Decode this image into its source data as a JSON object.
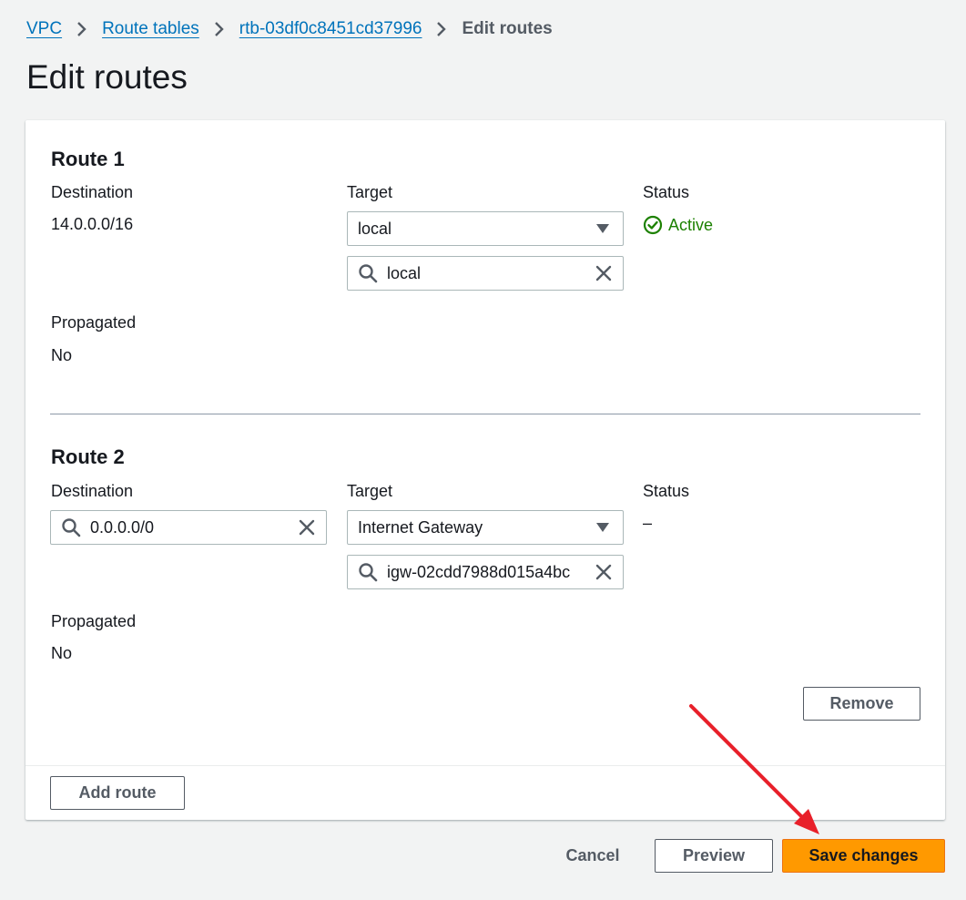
{
  "breadcrumb": {
    "items": [
      "VPC",
      "Route tables",
      "rtb-03df0c8451cd37996"
    ],
    "current": "Edit routes"
  },
  "page": {
    "title": "Edit routes"
  },
  "routes": [
    {
      "title": "Route 1",
      "destination_label": "Destination",
      "destination_value": "14.0.0.0/16",
      "target_label": "Target",
      "target_type": "local",
      "target_search_value": "local",
      "status_label": "Status",
      "status_value": "Active",
      "propagated_label": "Propagated",
      "propagated_value": "No"
    },
    {
      "title": "Route 2",
      "destination_label": "Destination",
      "destination_value": "0.0.0.0/0",
      "target_label": "Target",
      "target_type": "Internet Gateway",
      "target_search_value": "igw-02cdd7988d015a4bc",
      "status_label": "Status",
      "status_value": "–",
      "propagated_label": "Propagated",
      "propagated_value": "No",
      "remove_label": "Remove"
    }
  ],
  "panel": {
    "add_route_label": "Add route"
  },
  "actions": {
    "cancel_label": "Cancel",
    "preview_label": "Preview",
    "save_label": "Save changes"
  },
  "colors": {
    "link": "#0073bb",
    "status_active": "#1d8102",
    "primary_button": "#ff9900",
    "annotation_arrow": "#e8202a"
  },
  "icons": [
    "chevron-right-icon",
    "caret-down-icon",
    "search-icon",
    "close-icon",
    "check-circle-icon",
    "arrow-annotation"
  ]
}
